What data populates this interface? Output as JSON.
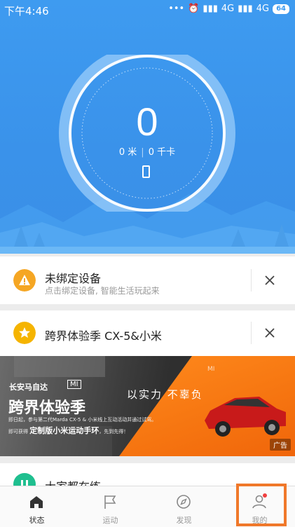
{
  "status_bar": {
    "time": "下午4:46",
    "net1": "4G",
    "net2": "4G",
    "battery": "64"
  },
  "hero": {
    "steps": "0",
    "distance": "0 米",
    "calories": "0 千卡"
  },
  "cards": {
    "device": {
      "title": "未绑定设备",
      "subtitle": "点击绑定设备, 智能生活玩起来"
    },
    "promo": {
      "title": "跨界体验季 CX-5&小米"
    },
    "partial": {
      "title": "大家都在练"
    }
  },
  "banner": {
    "brand": "长安马自达",
    "mi": "MI",
    "headline": "跨界体验季",
    "slogan": "以实力 不辜负",
    "desc_line1": "即日起，参与第二代Marda CX-5 & 小米线上互动活动并通过试驾。",
    "desc_line2_prefix": "即可获得 ",
    "desc_line2_bold": "定制版小米运动手环",
    "desc_line2_suffix": "，先到先得！",
    "ad": "广告"
  },
  "tabs": [
    {
      "label": "状态",
      "icon": "home-icon"
    },
    {
      "label": "运动",
      "icon": "flag-icon"
    },
    {
      "label": "发现",
      "icon": "compass-icon"
    },
    {
      "label": "我的",
      "icon": "user-icon"
    }
  ],
  "colors": {
    "hero": "#3e9bf0",
    "warning": "#f5a623",
    "star": "#f5b400",
    "accent": "#f0782a"
  }
}
